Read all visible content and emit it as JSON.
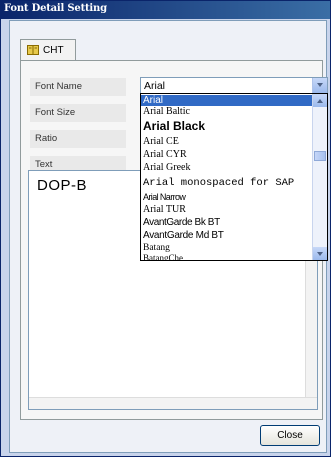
{
  "window": {
    "title": "Font Detail Setting"
  },
  "tabs": [
    {
      "label": "CHT",
      "icon": "book-icon"
    }
  ],
  "labels": {
    "font_name": "Font Name",
    "font_size": "Font Size",
    "ratio": "Ratio",
    "text": "Text"
  },
  "font_name_combo": {
    "value": "Arial"
  },
  "text_field": {
    "value": "DOP-B"
  },
  "font_list": {
    "items": [
      "Arial",
      "Arial Baltic",
      "Arial Black",
      "Arial CE",
      "Arial CYR",
      "Arial Greek",
      "Arial monospaced for SAP",
      "Arial Narrow",
      "Arial TUR",
      "AvantGarde Bk BT",
      "AvantGarde Md BT",
      "Batang",
      "BatangChe"
    ],
    "selected": "Arial"
  },
  "buttons": {
    "close": "Close"
  },
  "colors": {
    "selection": "#316ac5",
    "title_bar": "#0a246a"
  }
}
